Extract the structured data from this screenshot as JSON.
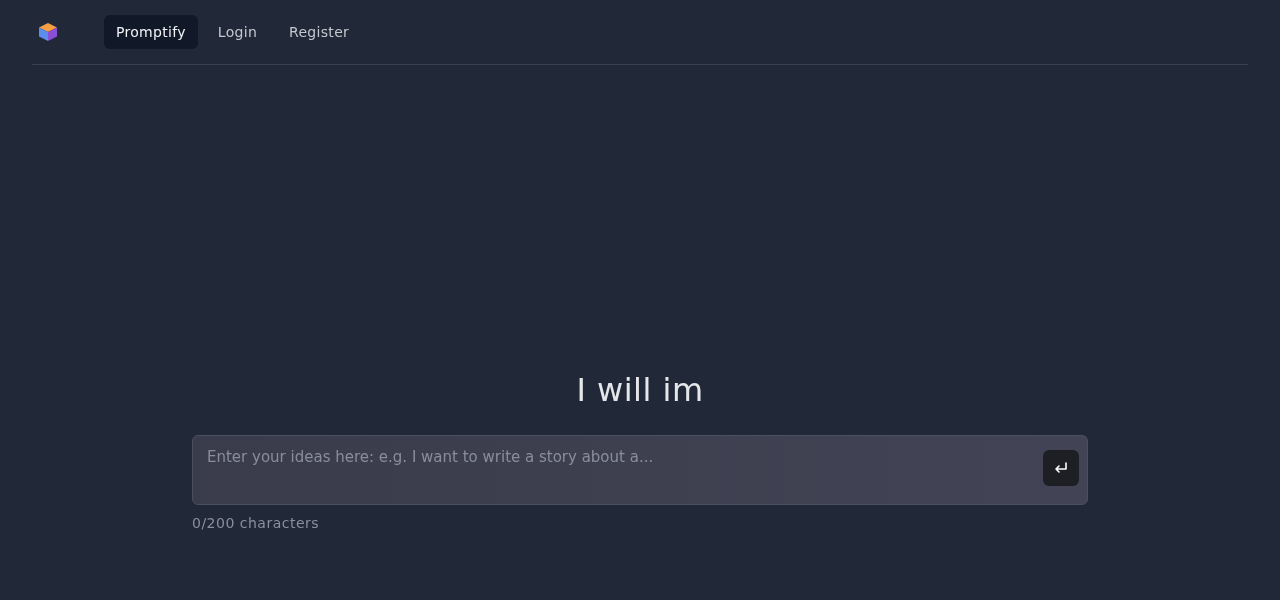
{
  "nav": {
    "items": [
      {
        "label": "Promptify",
        "selected": true
      },
      {
        "label": "Login",
        "selected": false
      },
      {
        "label": "Register",
        "selected": false
      }
    ]
  },
  "headline": "I will im",
  "prompt": {
    "placeholder": "Enter your ideas here: e.g. I want to write a story about a...",
    "counter": "0/200 characters"
  }
}
